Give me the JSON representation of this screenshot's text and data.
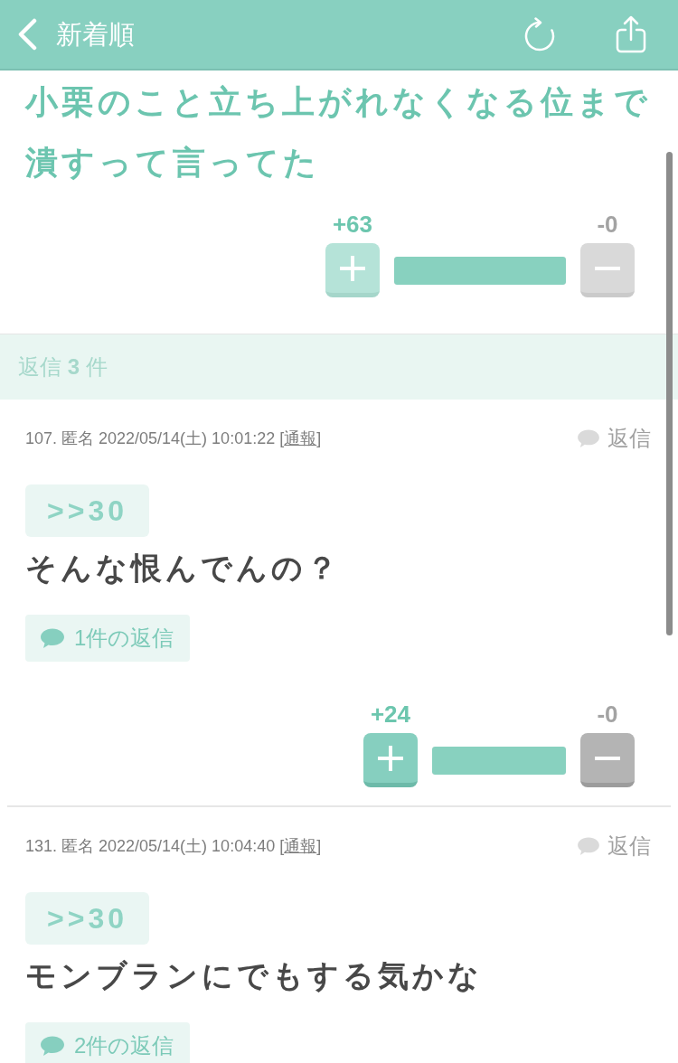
{
  "header": {
    "title": "新着順"
  },
  "post": {
    "title": "小栗のこと立ち上がれなくなる位まで潰すって言ってた",
    "votes": {
      "up": "+63",
      "down": "-0",
      "level": 1,
      "disabled": true
    }
  },
  "reply_count": {
    "text": "返信 **3** 件"
  },
  "comments": [
    {
      "meta_before": "107. 匿名 2022/05/14(土) 10:01:22 [",
      "report_link": "通報",
      "meta_after": "]",
      "reply_button": "返信",
      "anchor": ">>30",
      "body": "そんな恨んでんの？",
      "replies_button": "1件の返信",
      "votes": {
        "up": "+24",
        "down": "-0",
        "level": 1,
        "disabled": false
      }
    },
    {
      "meta_before": "131. 匿名 2022/05/14(土) 10:04:40 [",
      "report_link": "通報",
      "meta_after": "]",
      "reply_button": "返信",
      "anchor": ">>30",
      "body": "モンブランにでもする気かな",
      "replies_button": "2件の返信"
    }
  ]
}
